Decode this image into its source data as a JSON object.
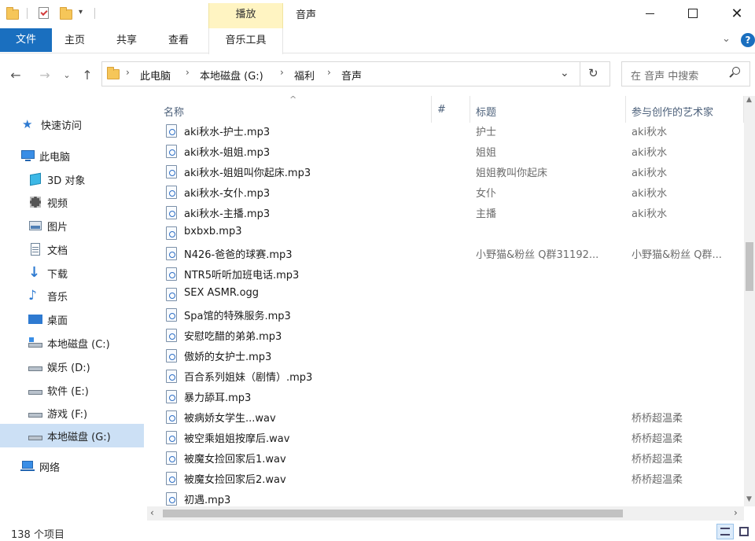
{
  "window": {
    "title": "音声",
    "context_tab_group": "播放"
  },
  "ribbon": {
    "tabs": [
      "文件",
      "主页",
      "共享",
      "查看",
      "音乐工具"
    ]
  },
  "address": {
    "crumbs": [
      "此电脑",
      "本地磁盘 (G:)",
      "福利",
      "音声"
    ]
  },
  "search": {
    "placeholder": "在 音声 中搜索"
  },
  "nav": {
    "items": [
      {
        "label": "快速访问",
        "icon": "star-icon"
      },
      {
        "label": "此电脑",
        "icon": "computer-icon"
      },
      {
        "label": "3D 对象",
        "icon": "cube-icon"
      },
      {
        "label": "视频",
        "icon": "video-icon"
      },
      {
        "label": "图片",
        "icon": "picture-icon"
      },
      {
        "label": "文档",
        "icon": "document-icon"
      },
      {
        "label": "下载",
        "icon": "download-icon"
      },
      {
        "label": "音乐",
        "icon": "music-icon"
      },
      {
        "label": "桌面",
        "icon": "desktop-icon"
      },
      {
        "label": "本地磁盘 (C:)",
        "icon": "drive-icon"
      },
      {
        "label": "娱乐 (D:)",
        "icon": "drive-icon"
      },
      {
        "label": "软件 (E:)",
        "icon": "drive-icon"
      },
      {
        "label": "游戏 (F:)",
        "icon": "drive-icon"
      },
      {
        "label": "本地磁盘 (G:)",
        "icon": "drive-icon",
        "selected": true
      },
      {
        "label": "网络",
        "icon": "network-icon"
      }
    ]
  },
  "columns": {
    "name": "名称",
    "number": "#",
    "title": "标题",
    "artist": "参与创作的艺术家"
  },
  "files": [
    {
      "name": "aki秋水-护士.mp3",
      "title": "护士",
      "artist": "aki秋水"
    },
    {
      "name": "aki秋水-姐姐.mp3",
      "title": "姐姐",
      "artist": "aki秋水"
    },
    {
      "name": "aki秋水-姐姐叫你起床.mp3",
      "title": "姐姐教叫你起床",
      "artist": "aki秋水"
    },
    {
      "name": "aki秋水-女仆.mp3",
      "title": "女仆",
      "artist": "aki秋水"
    },
    {
      "name": "aki秋水-主播.mp3",
      "title": "主播",
      "artist": "aki秋水"
    },
    {
      "name": "bxbxb.mp3",
      "title": "",
      "artist": ""
    },
    {
      "name": "N426-爸爸的球赛.mp3",
      "title": "小野猫&粉丝 Q群31192...",
      "artist": "小野猫&粉丝 Q群..."
    },
    {
      "name": "NTR5听听加班电话.mp3",
      "title": "",
      "artist": ""
    },
    {
      "name": "SEX ASMR.ogg",
      "title": "",
      "artist": ""
    },
    {
      "name": "Spa馆的特殊服务.mp3",
      "title": "",
      "artist": ""
    },
    {
      "name": "安慰吃醋的弟弟.mp3",
      "title": "",
      "artist": ""
    },
    {
      "name": "傲娇的女护士.mp3",
      "title": "",
      "artist": ""
    },
    {
      "name": "百合系列姐妹（剧情）.mp3",
      "title": "",
      "artist": ""
    },
    {
      "name": "暴力舔耳.mp3",
      "title": "",
      "artist": ""
    },
    {
      "name": "被病娇女学生...wav",
      "title": "",
      "artist": "桥桥超温柔"
    },
    {
      "name": "被空乘姐姐按摩后.wav",
      "title": "",
      "artist": "桥桥超温柔"
    },
    {
      "name": "被魔女捡回家后1.wav",
      "title": "",
      "artist": "桥桥超温柔"
    },
    {
      "name": "被魔女捡回家后2.wav",
      "title": "",
      "artist": "桥桥超温柔"
    },
    {
      "name": "初遇.mp3",
      "title": "",
      "artist": ""
    }
  ],
  "status": {
    "count": "138 个项目"
  },
  "colors": {
    "accent": "#1a6fbf",
    "selected": "#cce0f5",
    "context_tab": "#fff4c2"
  }
}
